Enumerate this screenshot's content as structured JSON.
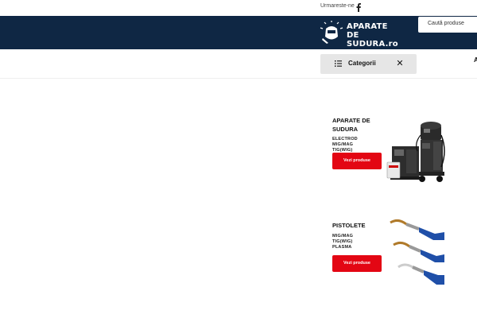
{
  "topbar": {
    "follow_label": "Urmareste-ne",
    "social_icon": "facebook-icon"
  },
  "header": {
    "logo_line_1": "APARATE",
    "logo_line_2": "DE SUDURA.ro",
    "search_placeholder": "Caută produse",
    "brand_color": "#0f2744"
  },
  "nav": {
    "categories_label": "Categorii",
    "list_icon": "list-icon",
    "close_icon": "close-icon",
    "partial_item": "A"
  },
  "cards": [
    {
      "title_line_1": "APARATE DE",
      "title_line_2": "SUDURA",
      "sub_1": "ELECTROD",
      "sub_2": "MIG/MAG",
      "sub_3": "TIG(WIG)",
      "button": "Vezi produse",
      "image_icon": "welding-machine-image"
    },
    {
      "title_line_1": "PISTOLETE",
      "sub_1": "MIG/MAG",
      "sub_2": "TIG(WIG)",
      "sub_3": "PLASMA",
      "button": "Vezi produse",
      "image_icon": "welding-torch-image"
    }
  ],
  "colors": {
    "accent_red": "#e30613",
    "category_bg": "#e6e6e6"
  }
}
